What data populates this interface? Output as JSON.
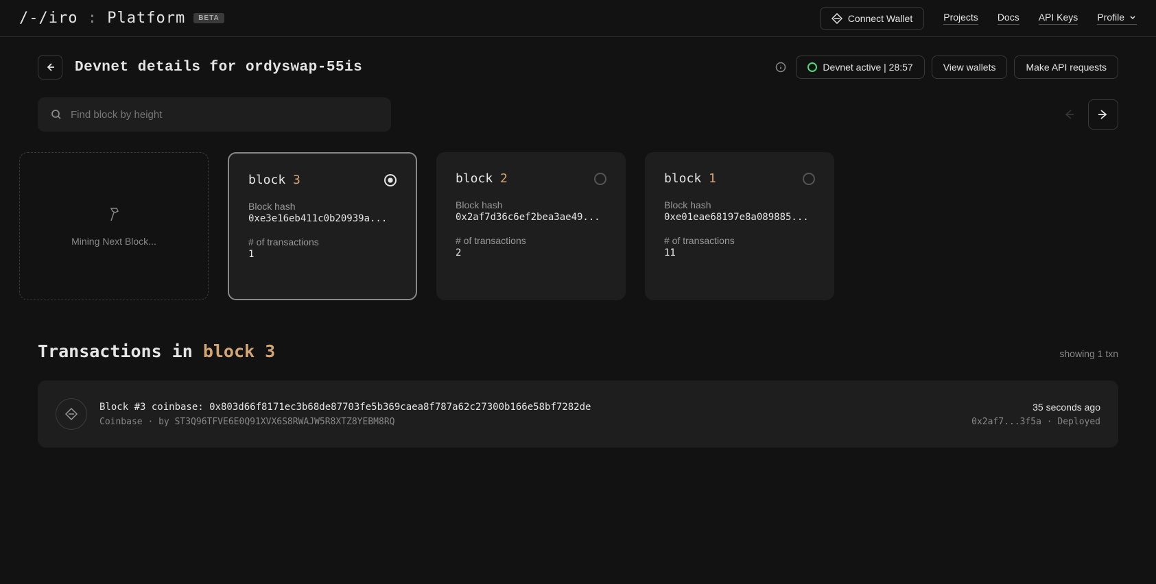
{
  "header": {
    "logo_prefix": "/-/iro",
    "logo_colon": " : ",
    "logo_suffix": "Platform",
    "beta": "BETA",
    "connect_wallet": "Connect Wallet",
    "nav": {
      "projects": "Projects",
      "docs": "Docs",
      "api_keys": "API Keys",
      "profile": "Profile"
    }
  },
  "subheader": {
    "title": "Devnet details for ordyswap-55is",
    "status": "Devnet active | 28:57",
    "view_wallets": "View wallets",
    "make_api": "Make API requests"
  },
  "search": {
    "placeholder": "Find block by height"
  },
  "mining": {
    "label": "Mining Next Block..."
  },
  "blocks": [
    {
      "label": "block ",
      "num": "3",
      "hash_label": "Block hash",
      "hash": "0xe3e16eb411c0b20939a...",
      "txn_label": "# of transactions",
      "txn_count": "1",
      "selected": true
    },
    {
      "label": "block ",
      "num": "2",
      "hash_label": "Block hash",
      "hash": "0x2af7d36c6ef2bea3ae49...",
      "txn_label": "# of transactions",
      "txn_count": "2",
      "selected": false
    },
    {
      "label": "block ",
      "num": "1",
      "hash_label": "Block hash",
      "hash": "0xe01eae68197e8a089885...",
      "txn_label": "# of transactions",
      "txn_count": "11",
      "selected": false
    }
  ],
  "transactions": {
    "title_prefix": "Transactions in ",
    "title_block": "block 3",
    "showing": "showing 1 txn",
    "items": [
      {
        "line1": "Block #3 coinbase: 0x803d66f8171ec3b68de87703fe5b369caea8f787a62c27300b166e58bf7282de",
        "line2": "Coinbase · by ST3Q96TFVE6E0Q91XVX6S8RWAJW5R8XTZ8YEBM8RQ",
        "time": "35 seconds ago",
        "meta": "0x2af7...3f5a · Deployed"
      }
    ]
  }
}
